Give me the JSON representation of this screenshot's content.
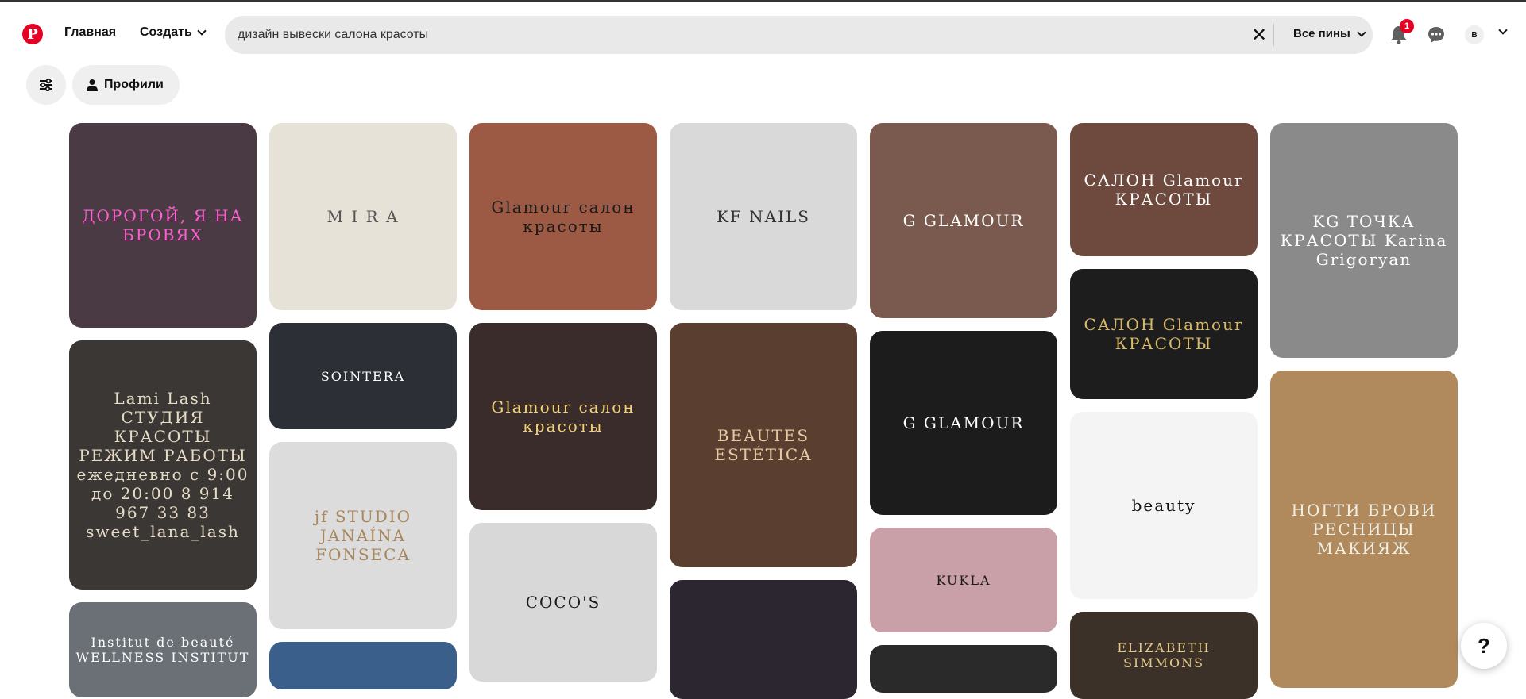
{
  "colors": {
    "brand": "#e60023",
    "search_bg": "#e9e9e9",
    "chip_bg": "#efefef"
  },
  "header": {
    "logo_letter": "P",
    "home_label": "Главная",
    "create_label": "Создать",
    "search_value": "дизайн вывески салона красоты",
    "scope_label": "Все пины",
    "notifications_count": "1",
    "avatar_letter": "B"
  },
  "filters": {
    "profiles_label": "Профили"
  },
  "help": {
    "label": "?"
  },
  "pins": [
    {
      "col": 0,
      "alt": "ДОРОГОЙ, Я НА БРОВЯХ",
      "bg": "#4a3a44",
      "fg": "#ff5fd1"
    },
    {
      "col": 0,
      "alt": "Lami Lash СТУДИЯ КРАСОТЫ РЕЖИМ РАБОТЫ ежедневно с 9:00 до 20:00 8 914 967 33 83 sweet_lana_lash",
      "bg": "#3a3734",
      "fg": "#e7dcc6"
    },
    {
      "col": 0,
      "alt": "Institut de beauté WELLNESS INSTITUT",
      "bg": "#6a7076",
      "fg": "#ffffff"
    },
    {
      "col": 1,
      "alt": "M I R A",
      "bg": "#e6e2d8",
      "fg": "#555555"
    },
    {
      "col": 1,
      "alt": "SOINTERA",
      "bg": "#2c2f35",
      "fg": "#ffffff"
    },
    {
      "col": 1,
      "alt": "jf STUDIO JANAÍNA FONSECA",
      "bg": "#dcdcdc",
      "fg": "#a9865b"
    },
    {
      "col": 1,
      "alt": "",
      "bg": "#3a5f8a",
      "fg": "#ffffff"
    },
    {
      "col": 2,
      "alt": "Glamour салон красоты",
      "bg": "#9c5a45",
      "fg": "#1a1a1a"
    },
    {
      "col": 2,
      "alt": "Glamour салон красоты",
      "bg": "#3a2c2a",
      "fg": "#f2d27a"
    },
    {
      "col": 2,
      "alt": "COCO'S",
      "bg": "#d8d8d8",
      "fg": "#1a1a1a"
    },
    {
      "col": 3,
      "alt": "KF NAILS",
      "bg": "#d9d9d9",
      "fg": "#333333"
    },
    {
      "col": 3,
      "alt": "BEAUTES ESTÉTICA",
      "bg": "#5a3e2f",
      "fg": "#e7c9a3"
    },
    {
      "col": 3,
      "alt": "",
      "bg": "#2b2630",
      "fg": "#ff5ab0"
    },
    {
      "col": 4,
      "alt": "G GLAMOUR",
      "bg": "#7a5a4e",
      "fg": "#ffffff"
    },
    {
      "col": 4,
      "alt": "G GLAMOUR",
      "bg": "#1c1c1c",
      "fg": "#ffffff"
    },
    {
      "col": 4,
      "alt": "KUKLA",
      "bg": "#c9a0a7",
      "fg": "#1a1a1a"
    },
    {
      "col": 4,
      "alt": "",
      "bg": "#2a2a2a",
      "fg": "#ffffff"
    },
    {
      "col": 5,
      "alt": "САЛОН Glamour КРАСОТЫ",
      "bg": "#6e4a3e",
      "fg": "#ffffff"
    },
    {
      "col": 5,
      "alt": "САЛОН Glamour КРАСОТЫ",
      "bg": "#1d1d1d",
      "fg": "#d8b869"
    },
    {
      "col": 5,
      "alt": "beauty",
      "bg": "#f4f4f4",
      "fg": "#111111"
    },
    {
      "col": 5,
      "alt": "ELIZABETH SIMMONS",
      "bg": "#3b3128",
      "fg": "#e2c88b"
    },
    {
      "col": 6,
      "alt": "KG ТОЧКА КРАСОТЫ Karina Grigoryan",
      "bg": "#8a8a8a",
      "fg": "#ffffff"
    },
    {
      "col": 6,
      "alt": "НОГТИ БРОВИ РЕСНИЦЫ МАКИЯЖ",
      "bg": "#b08a5c",
      "fg": "#f0efe6"
    }
  ]
}
